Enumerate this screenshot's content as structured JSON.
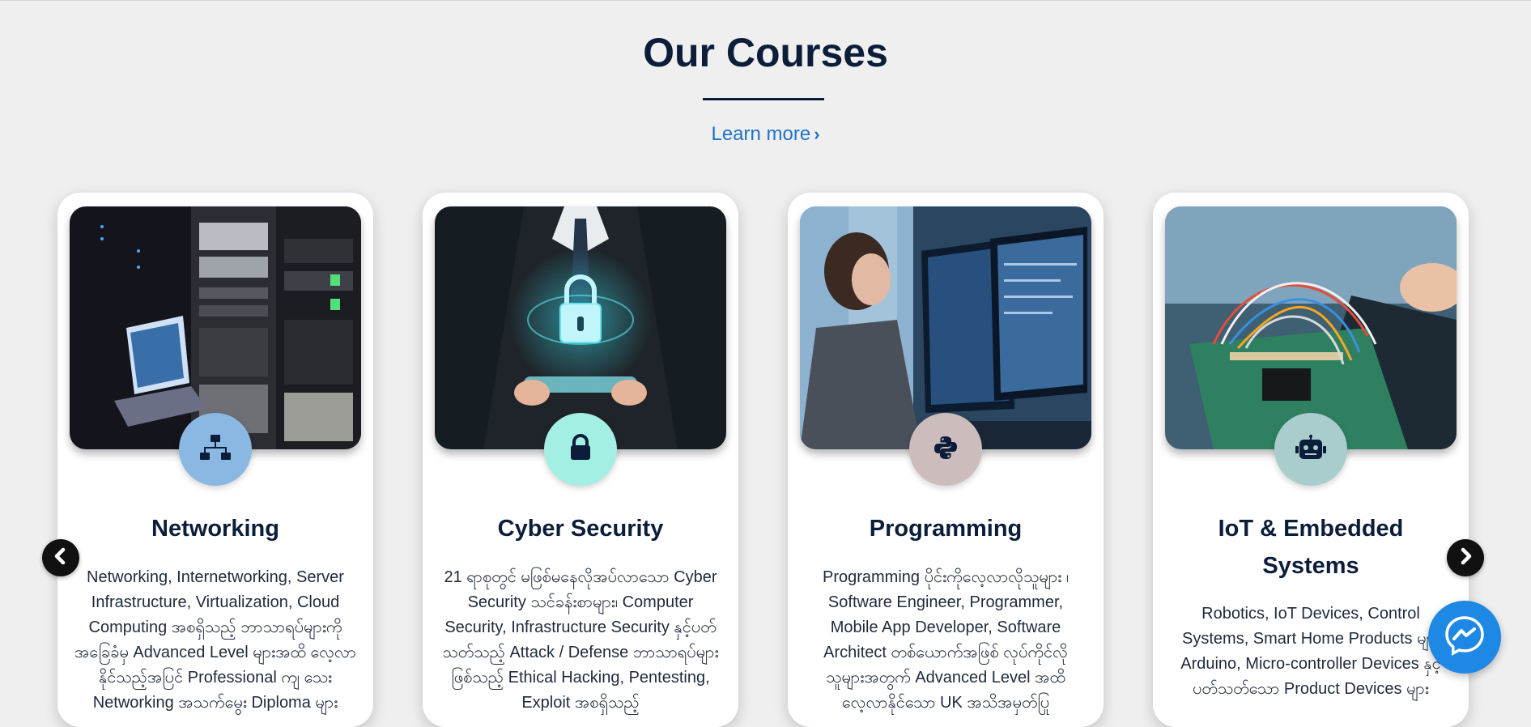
{
  "header": {
    "title": "Our Courses",
    "learn_more_label": "Learn more",
    "learn_more_icon": "chevron-right-icon"
  },
  "colors": {
    "heading": "#0c1d3a",
    "link": "#1f73c7",
    "background": "#efeff0"
  },
  "courses": [
    {
      "title": "Networking",
      "icon": "network-icon",
      "badge_color": "#8ab8e3",
      "description": "Networking, Internetworking, Server Infrastructure, Virtualization, Cloud Computing အစရှိသည့် ဘာသာရပ်များကို အခြေခံမှ Advanced Level များအထိ လေ့လာနိုင်သည့်အပြင် Professional ကျ သေး Networking အသက်မွေး Diploma များ"
    },
    {
      "title": "Cyber Security",
      "icon": "lock-icon",
      "badge_color": "#a3efe3",
      "description": "21 ရာစုတွင် မဖြစ်မနေလိုအပ်လာသော Cyber Security သင်ခန်းစာများ၊ Computer Security, Infrastructure Security နှင့်ပတ်သတ်သည့် Attack / Defense ဘာသာရပ်များဖြစ်သည့် Ethical Hacking, Pentesting, Exploit အစရှိသည့်"
    },
    {
      "title": "Programming",
      "icon": "python-icon",
      "badge_color": "#cdbcbc",
      "description": "Programming ပိုင်းကိုလေ့လာလိုသူများ ၊ Software Engineer, Programmer, Mobile App Developer, Software Architect တစ်ယောက်အဖြစ် လုပ်ကိုင်လို သူများအတွက် Advanced Level အထိ လေ့လာနိုင်သော UK အသိအမှတ်ပြု"
    },
    {
      "title_line1": "IoT & Embedded",
      "title_line2": "Systems",
      "icon": "robot-icon",
      "badge_color": "#a9cdcc",
      "description": "Robotics, IoT Devices, Control Systems, Smart Home Products များ Arduino, Micro-controller Devices နှင့် ပတ်သတ်သော Product Devices များ"
    }
  ],
  "nav": {
    "prev_icon": "chevron-left-icon",
    "next_icon": "chevron-right-icon"
  },
  "chat": {
    "icon": "messenger-icon"
  }
}
